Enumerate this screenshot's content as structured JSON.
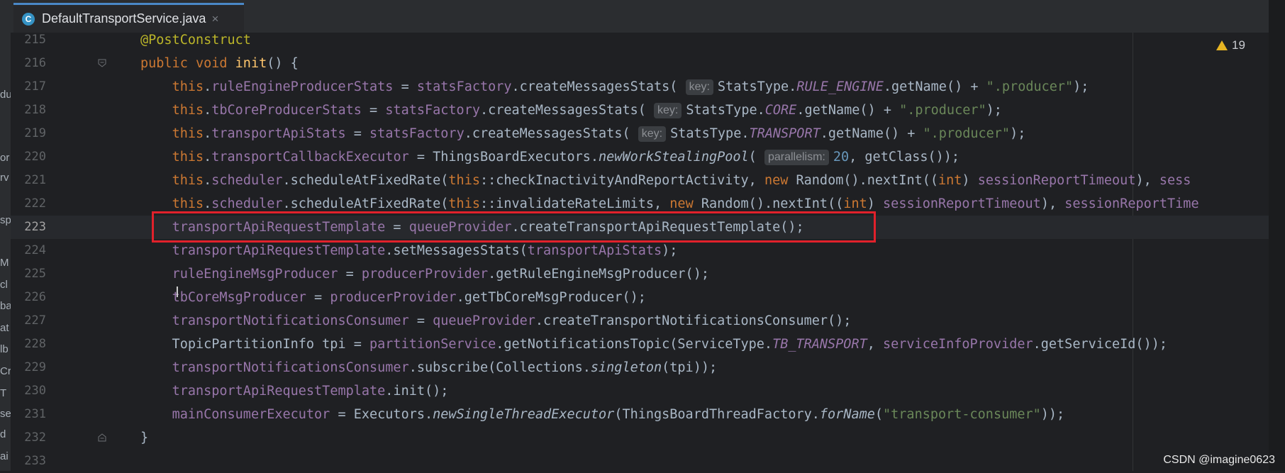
{
  "tab": {
    "icon_letter": "C",
    "filename": "DefaultTransportService.java",
    "close_glyph": "×"
  },
  "inspections": {
    "warning_icon": "warning-triangle-icon",
    "warning_count": "19"
  },
  "watermark": "CSDN @imagine0623",
  "left_strip": [
    "du",
    "or",
    "rv",
    "sp",
    "M",
    "cl",
    "ba",
    "at",
    "lb",
    "Cr",
    "T",
    "se",
    "d",
    "ai"
  ],
  "lines": [
    {
      "number": "215"
    },
    {
      "number": "216"
    },
    {
      "number": "217"
    },
    {
      "number": "218"
    },
    {
      "number": "219"
    },
    {
      "number": "220"
    },
    {
      "number": "221"
    },
    {
      "number": "222"
    },
    {
      "number": "223"
    },
    {
      "number": "224"
    },
    {
      "number": "225"
    },
    {
      "number": "226"
    },
    {
      "number": "227"
    },
    {
      "number": "228"
    },
    {
      "number": "229"
    },
    {
      "number": "230"
    },
    {
      "number": "231"
    },
    {
      "number": "232"
    },
    {
      "number": "233"
    }
  ],
  "code": {
    "l215": [
      [
        "ann",
        "@PostConstruct"
      ]
    ],
    "l216": [
      [
        "kw",
        "public "
      ],
      [
        "kw",
        "void "
      ],
      [
        "fn",
        "init"
      ],
      [
        "",
        "() {"
      ]
    ],
    "l217": [
      [
        "",
        "    "
      ],
      [
        "kw",
        "this"
      ],
      [
        "",
        "."
      ],
      [
        "fld",
        "ruleEngineProducerStats"
      ],
      [
        "",
        " = "
      ],
      [
        "fld",
        "statsFactory"
      ],
      [
        "",
        ".createMessagesStats( "
      ],
      [
        "hint",
        "key:"
      ],
      [
        "",
        "StatsType."
      ],
      [
        "ifld",
        "RULE_ENGINE"
      ],
      [
        "",
        ".getName() + "
      ],
      [
        "str",
        "\".producer\""
      ],
      [
        "",
        ");"
      ]
    ],
    "l218": [
      [
        "",
        "    "
      ],
      [
        "kw",
        "this"
      ],
      [
        "",
        "."
      ],
      [
        "fld",
        "tbCoreProducerStats"
      ],
      [
        "",
        " = "
      ],
      [
        "fld",
        "statsFactory"
      ],
      [
        "",
        ".createMessagesStats( "
      ],
      [
        "hint",
        "key:"
      ],
      [
        "",
        "StatsType."
      ],
      [
        "ifld",
        "CORE"
      ],
      [
        "",
        ".getName() + "
      ],
      [
        "str",
        "\".producer\""
      ],
      [
        "",
        ");"
      ]
    ],
    "l219": [
      [
        "",
        "    "
      ],
      [
        "kw",
        "this"
      ],
      [
        "",
        "."
      ],
      [
        "fld",
        "transportApiStats"
      ],
      [
        "",
        " = "
      ],
      [
        "fld",
        "statsFactory"
      ],
      [
        "",
        ".createMessagesStats( "
      ],
      [
        "hint",
        "key:"
      ],
      [
        "",
        "StatsType."
      ],
      [
        "ifld",
        "TRANSPORT"
      ],
      [
        "",
        ".getName() + "
      ],
      [
        "str",
        "\".producer\""
      ],
      [
        "",
        ");"
      ]
    ],
    "l220": [
      [
        "",
        "    "
      ],
      [
        "kw",
        "this"
      ],
      [
        "",
        "."
      ],
      [
        "fld",
        "transportCallbackExecutor"
      ],
      [
        "",
        " = ThingsBoardExecutors."
      ],
      [
        "ital",
        "newWorkStealingPool"
      ],
      [
        "",
        "( "
      ],
      [
        "hint",
        "parallelism:"
      ],
      [
        "num",
        "20"
      ],
      [
        "",
        ", getClass());"
      ]
    ],
    "l221": [
      [
        "",
        "    "
      ],
      [
        "kw",
        "this"
      ],
      [
        "",
        "."
      ],
      [
        "fld",
        "scheduler"
      ],
      [
        "",
        ".scheduleAtFixedRate("
      ],
      [
        "kw",
        "this"
      ],
      [
        "",
        "::checkInactivityAndReportActivity, "
      ],
      [
        "kw",
        "new "
      ],
      [
        "",
        "Random().nextInt(("
      ],
      [
        "kw",
        "int"
      ],
      [
        "",
        ") "
      ],
      [
        "fld",
        "sessionReportTimeout"
      ],
      [
        "",
        "), "
      ],
      [
        "fld",
        "sess"
      ]
    ],
    "l222": [
      [
        "",
        "    "
      ],
      [
        "kw",
        "this"
      ],
      [
        "",
        "."
      ],
      [
        "fld",
        "scheduler"
      ],
      [
        "",
        ".scheduleAtFixedRate("
      ],
      [
        "kw",
        "this"
      ],
      [
        "",
        "::invalidateRateLimits, "
      ],
      [
        "kw",
        "new "
      ],
      [
        "",
        "Random().nextInt(("
      ],
      [
        "kw",
        "int"
      ],
      [
        "",
        ") "
      ],
      [
        "fld",
        "sessionReportTimeout"
      ],
      [
        "",
        "), "
      ],
      [
        "fld",
        "sessionReportTime"
      ]
    ],
    "l223": [
      [
        "",
        "    "
      ],
      [
        "fld",
        "transportApiRequestTemplate"
      ],
      [
        "",
        " = "
      ],
      [
        "fld",
        "queueProvider"
      ],
      [
        "",
        ".createTransportApiRequestTemplate();"
      ]
    ],
    "l224": [
      [
        "",
        "    "
      ],
      [
        "fld",
        "transportApiRequestTemplate"
      ],
      [
        "",
        ".setMessagesStats("
      ],
      [
        "fld",
        "transportApiStats"
      ],
      [
        "",
        ");"
      ]
    ],
    "l225": [
      [
        "",
        "    "
      ],
      [
        "fld",
        "ruleEngineMsgProducer"
      ],
      [
        "",
        " = "
      ],
      [
        "fld",
        "producerProvider"
      ],
      [
        "",
        ".getRuleEngineMsgProducer();"
      ]
    ],
    "l226": [
      [
        "",
        "    "
      ],
      [
        "fld",
        "tbCoreMsgProducer"
      ],
      [
        "",
        " = "
      ],
      [
        "fld",
        "producerProvider"
      ],
      [
        "",
        ".getTbCoreMsgProducer();"
      ]
    ],
    "l227": [
      [
        "",
        "    "
      ],
      [
        "fld",
        "transportNotificationsConsumer"
      ],
      [
        "",
        " = "
      ],
      [
        "fld",
        "queueProvider"
      ],
      [
        "",
        ".createTransportNotificationsConsumer();"
      ]
    ],
    "l228": [
      [
        "",
        "    TopicPartitionInfo tpi = "
      ],
      [
        "fld",
        "partitionService"
      ],
      [
        "",
        ".getNotificationsTopic(ServiceType."
      ],
      [
        "ifld",
        "TB_TRANSPORT"
      ],
      [
        "",
        ", "
      ],
      [
        "fld",
        "serviceInfoProvider"
      ],
      [
        "",
        ".getServiceId());"
      ]
    ],
    "l229": [
      [
        "",
        "    "
      ],
      [
        "fld",
        "transportNotificationsConsumer"
      ],
      [
        "",
        ".subscribe(Collections."
      ],
      [
        "ital",
        "singleton"
      ],
      [
        "",
        "(tpi));"
      ]
    ],
    "l230": [
      [
        "",
        "    "
      ],
      [
        "fld",
        "transportApiRequestTemplate"
      ],
      [
        "",
        ".init();"
      ]
    ],
    "l231": [
      [
        "",
        "    "
      ],
      [
        "fld",
        "mainConsumerExecutor"
      ],
      [
        "",
        " = Executors."
      ],
      [
        "ital",
        "newSingleThreadExecutor"
      ],
      [
        "",
        "(ThingsBoardThreadFactory."
      ],
      [
        "ital",
        "forName"
      ],
      [
        "",
        "("
      ],
      [
        "str",
        "\"transport-consumer\""
      ],
      [
        "",
        "));"
      ]
    ],
    "l232": [
      [
        "",
        "}"
      ]
    ],
    "l233": []
  }
}
